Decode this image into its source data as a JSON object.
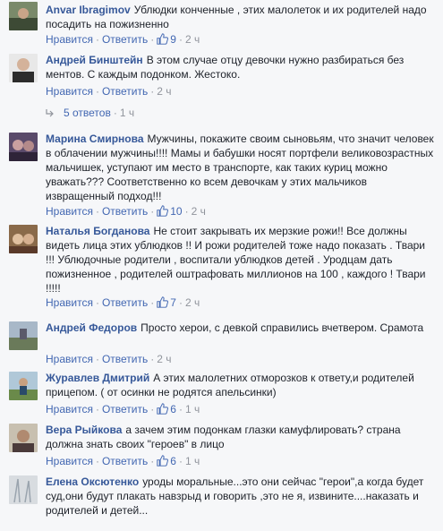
{
  "actions": {
    "like": "Нравится",
    "reply": "Ответить",
    "sep": "·"
  },
  "comments": [
    {
      "author": "Anvar Ibragimov",
      "text": "Ублюдки конченные , этих малолеток и их родителей надо посадить на пожизненно",
      "likes": "9",
      "time": "2 ч"
    },
    {
      "author": "Андрей Бинштейн",
      "text": "В этом случае отцу девочки нужно разбираться без ментов. С каждым подонком. Жестоко.",
      "likes": "",
      "time": "2 ч"
    },
    {
      "author": "Марина Смирнова",
      "text": "Мужчины, покажите своим сыновьям, что значит человек в облачении мужчины!!!! Мамы и бабушки носят портфели великовозрастных мальчишек, уступают им место в транспорте, как таких куриц можно уважать??? Соответственно ко всем девочкам у этих мальчиков извращенный подход!!!",
      "likes": "10",
      "time": "2 ч"
    },
    {
      "author": "Наталья Богданова",
      "text": "Не стоит закрывать их мерзкие рожи!! Все должны видеть лица этих ублюдков !! И рожи родителей тоже надо показать . Твари !!! Ублюдочные родители , воспитали ублюдков детей . Уродцам дать пожизненное , родителей оштрафовать миллионов на 100 , каждого ! Твари !!!!!",
      "likes": "7",
      "time": "2 ч"
    },
    {
      "author": "Андрей Федоров",
      "text": "Просто херои, с девкой справились вчетвером. Срамота",
      "likes": "",
      "time": "2 ч"
    },
    {
      "author": "Журавлев Дмитрий",
      "text": "А этих малолетних отморозков к ответу,и родителей прицепом. ( от осинки не родятся апельсинки)",
      "likes": "6",
      "time": "1 ч"
    },
    {
      "author": "Вера Рыйкова",
      "text": "а зачем этим подонкам глазки камуфлировать? страна должна знать своих \"героев\" в лицо",
      "likes": "6",
      "time": "1 ч"
    },
    {
      "author": "Елена Оксютенко",
      "text": "уроды моральные...это они сейчас \"герои\",а когда будет суд,они будут плакать навзрыд и говорить ,это не я, извините....наказать и родителей и детей...",
      "likes": "",
      "time": ""
    }
  ],
  "replies": {
    "label": "5 ответов",
    "time": "1 ч"
  }
}
